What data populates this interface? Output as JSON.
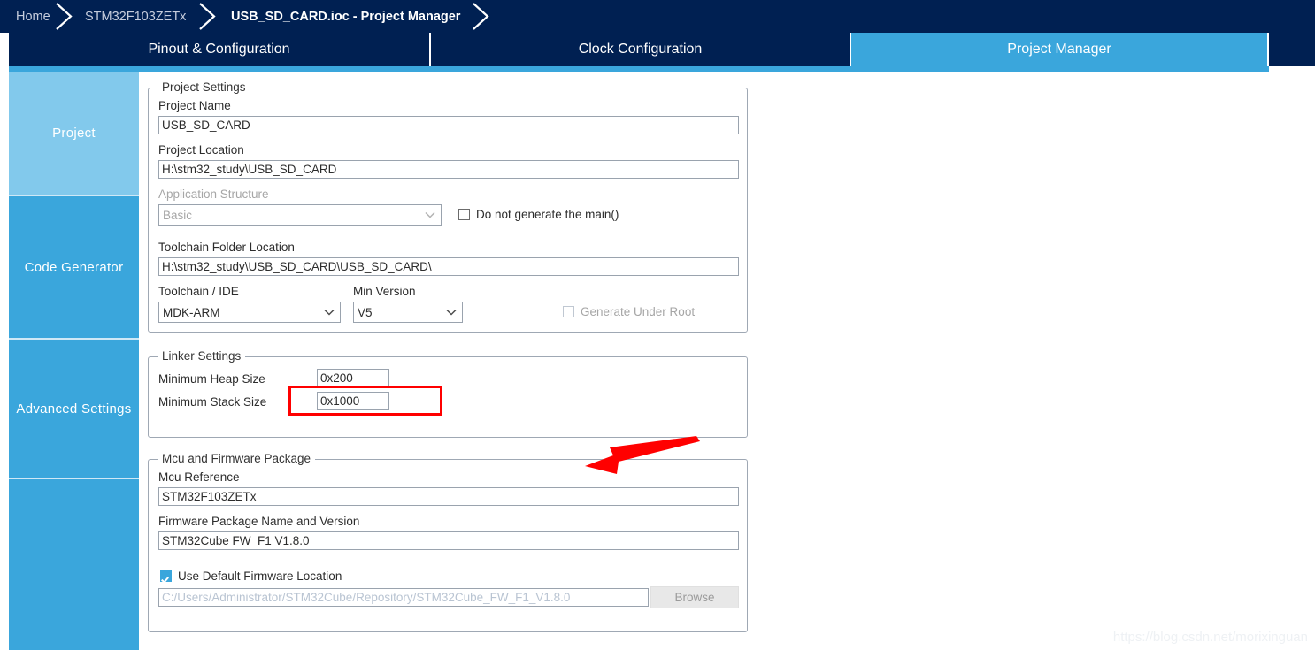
{
  "window": {
    "title": "USB_SD_CARD.ioc - Project Manager"
  },
  "breadcrumb": {
    "items": [
      {
        "label": "Home",
        "active": false
      },
      {
        "label": "STM32F103ZETx",
        "active": false
      },
      {
        "label": "USB_SD_CARD.ioc - Project Manager",
        "active": true
      }
    ]
  },
  "tabs": [
    {
      "label": "Pinout & Configuration",
      "selected": false
    },
    {
      "label": "Clock Configuration",
      "selected": false
    },
    {
      "label": "Project Manager",
      "selected": true
    },
    {
      "label": "",
      "selected": false
    }
  ],
  "sidebar": {
    "items": [
      {
        "label": "Project",
        "selected": true
      },
      {
        "label": "Code Generator",
        "selected": false
      },
      {
        "label": "Advanced Settings",
        "selected": false
      },
      {
        "label": "",
        "selected": false
      }
    ]
  },
  "project_settings": {
    "group_title": "Project Settings",
    "project_name_label": "Project Name",
    "project_name_value": "USB_SD_CARD",
    "project_location_label": "Project Location",
    "project_location_value": "H:\\stm32_study\\USB_SD_CARD",
    "application_structure_label": "Application Structure",
    "application_structure_value": "Basic",
    "do_not_generate_main_label": "Do not generate the main()",
    "do_not_generate_main_checked": false,
    "toolchain_folder_label": "Toolchain Folder Location",
    "toolchain_folder_value": "H:\\stm32_study\\USB_SD_CARD\\USB_SD_CARD\\",
    "toolchain_ide_label": "Toolchain / IDE",
    "toolchain_ide_value": "MDK-ARM",
    "min_version_label": "Min Version",
    "min_version_value": "V5",
    "generate_under_root_label": "Generate Under Root",
    "generate_under_root_checked": false
  },
  "linker_settings": {
    "group_title": "Linker Settings",
    "heap_label": "Minimum Heap Size",
    "heap_value": "0x200",
    "stack_label": "Minimum Stack Size",
    "stack_value": "0x1000"
  },
  "mcu_firmware": {
    "group_title": "Mcu and Firmware Package",
    "mcu_reference_label": "Mcu Reference",
    "mcu_reference_value": "STM32F103ZETx",
    "firmware_package_label": "Firmware Package Name and Version",
    "firmware_package_value": "STM32Cube FW_F1 V1.8.0",
    "use_default_location_label": "Use Default Firmware Location",
    "use_default_location_checked": true,
    "firmware_path_value": "C:/Users/Administrator/STM32Cube/Repository/STM32Cube_FW_F1_V1.8.0",
    "browse_label": "Browse"
  },
  "annotation": {
    "highlight_target": "Minimum Stack Size",
    "highlight_color": "#ff0000"
  },
  "watermark": {
    "text": "https://blog.csdn.net/morixinguan"
  },
  "colors": {
    "navy": "#002052",
    "accent_blue": "#3aa6dc",
    "selected_blue": "#82c9ec",
    "annotation_red": "#ff0000"
  }
}
